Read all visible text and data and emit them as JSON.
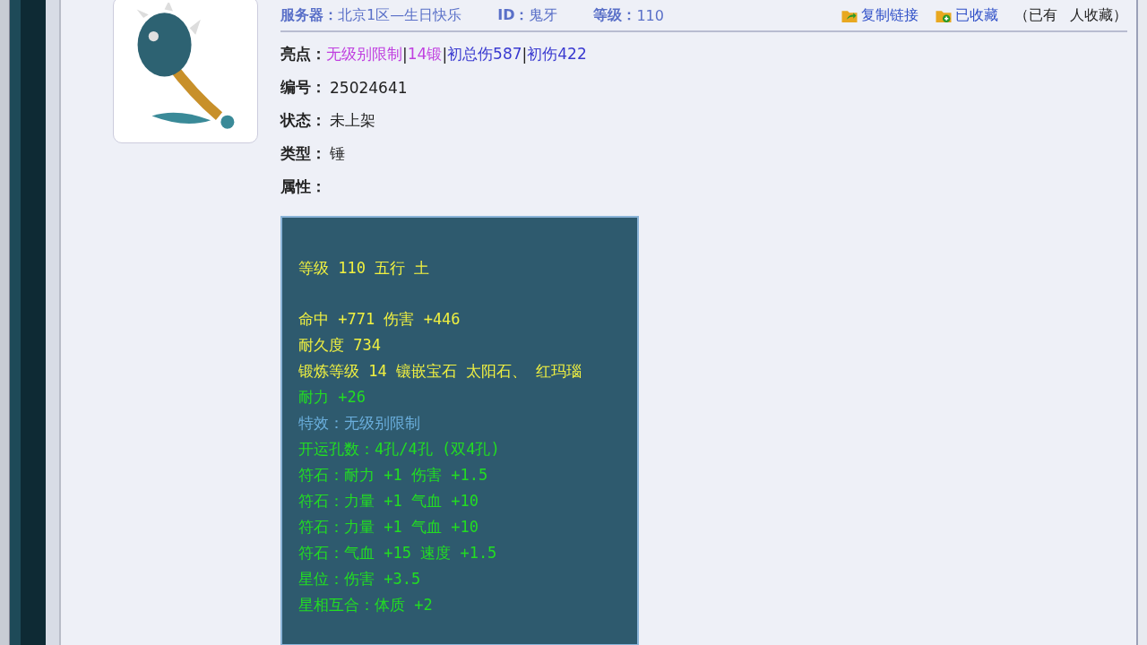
{
  "header": {
    "server_label": "服务器：",
    "server": "北京1区—生日快乐",
    "id_label": "ID：",
    "id": "鬼牙",
    "level_label": "等级：",
    "level": "110",
    "actions": [
      {
        "kind": "share",
        "label": "复制链接"
      },
      {
        "kind": "favorite",
        "label": "已收藏"
      }
    ],
    "favorites_prefix": "（已有",
    "favorites_suffix": "人收藏）"
  },
  "highlights": {
    "label": "亮点：",
    "separator": "|",
    "items": [
      {
        "text": "无级别限制",
        "color": "#c040e0"
      },
      {
        "text": "14锻",
        "color": "#c040e0"
      },
      {
        "text": "初总伤587",
        "color": "#3a3ad0"
      },
      {
        "text": "初伤422",
        "color": "#3a3ad0"
      }
    ]
  },
  "fields": [
    {
      "label": "编号：",
      "value": "25024641"
    },
    {
      "label": "状态：",
      "value": "未上架"
    },
    {
      "label": "类型：",
      "value": "锤"
    },
    {
      "label": "属性："
    }
  ],
  "attributes": [
    {
      "kind": "gap"
    },
    {
      "kind": "base",
      "text": "等级 110 五行 土"
    },
    {
      "kind": "gap"
    },
    {
      "kind": "base",
      "text": "命中 +771 伤害 +446"
    },
    {
      "kind": "base",
      "text": "耐久度 734"
    },
    {
      "kind": "base",
      "text": "锻炼等级 14 镶嵌宝石 太阳石、 红玛瑙"
    },
    {
      "kind": "bonus",
      "text": "耐力 +26"
    },
    {
      "kind": "special",
      "text": "特效：无级别限制"
    },
    {
      "kind": "bonus",
      "text": "开运孔数：4孔/4孔 (双4孔)"
    },
    {
      "kind": "bonus",
      "text": "符石：耐力 +1 伤害 +1.5"
    },
    {
      "kind": "bonus",
      "text": "符石：力量 +1 气血 +10"
    },
    {
      "kind": "bonus",
      "text": "符石：力量 +1 气血 +10"
    },
    {
      "kind": "bonus",
      "text": "符石：气血 +15 速度 +1.5"
    },
    {
      "kind": "bonus",
      "text": "星位：伤害 +3.5"
    },
    {
      "kind": "bonus",
      "text": "星相互合：体质 +2"
    }
  ]
}
